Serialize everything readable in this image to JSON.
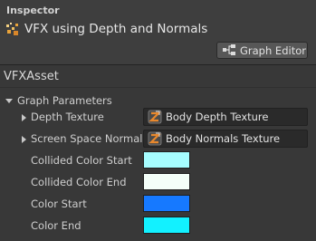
{
  "header": {
    "tab_label": "Inspector",
    "title": "VFX using Depth and Normals",
    "graph_editor_label": "Graph Editor"
  },
  "asset": {
    "title": "VFXAsset"
  },
  "graph_parameters": {
    "label": "Graph Parameters",
    "expanded": true,
    "properties": [
      {
        "label": "Depth Texture",
        "type": "texture",
        "value": "Body Depth Texture",
        "icon": "render-texture-icon"
      },
      {
        "label": "Screen Space Normals",
        "type": "texture",
        "value": "Body Normals Texture",
        "icon": "render-texture-icon"
      },
      {
        "label": "Collided Color Start",
        "type": "color",
        "color": "#a6fdff"
      },
      {
        "label": "Collided Color End",
        "type": "color",
        "color": "#f4fff9"
      },
      {
        "label": "Color Start",
        "type": "color",
        "color": "#1679ff"
      },
      {
        "label": "Color End",
        "type": "color",
        "color": "#12f1ff"
      }
    ]
  },
  "colors": {
    "background": "#383838",
    "header_background": "#3e3e3e",
    "field_background": "#2a2a2a",
    "button_background": "#575757",
    "icon_orange": "#e8882d"
  }
}
